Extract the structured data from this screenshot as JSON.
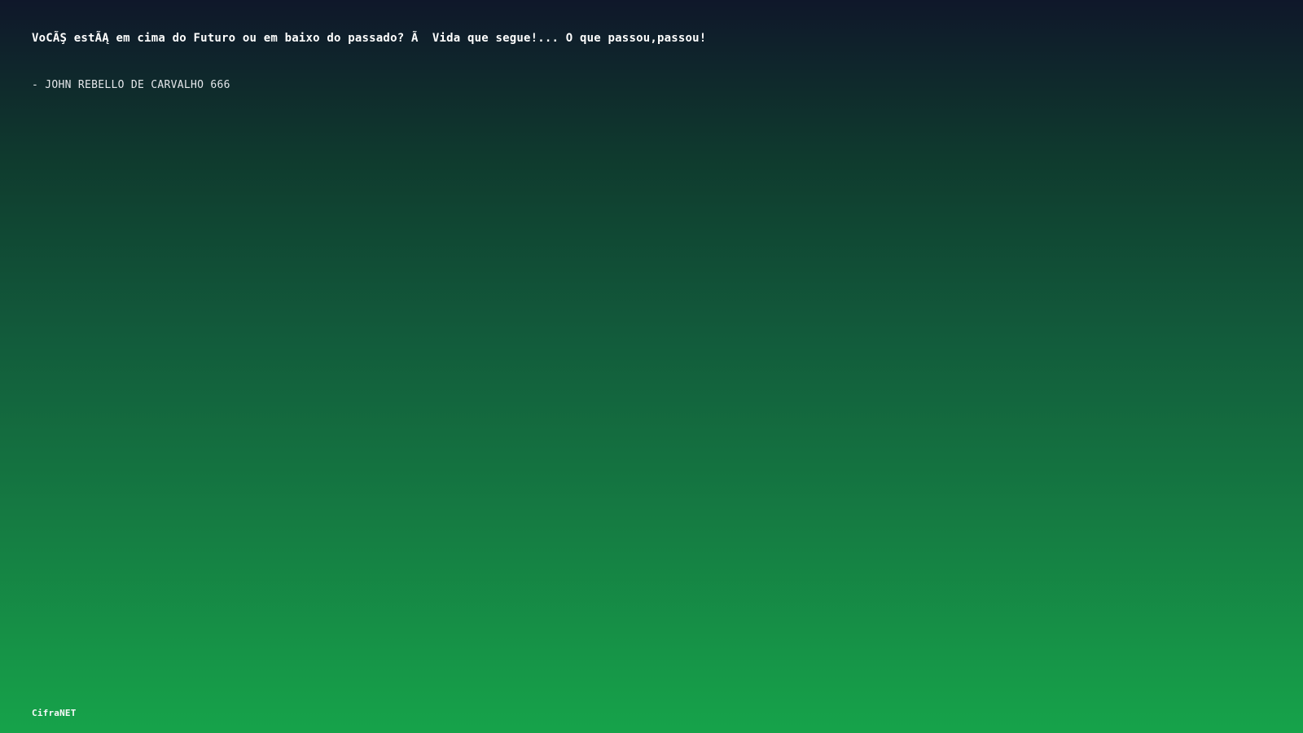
{
  "quote": {
    "text": "VoCÃŞ estÃĄ em cima do Futuro ou em baixo do passado? Ã  Vida que segue!... O que passou,passou!",
    "author": "- JOHN REBELLO DE CARVALHO 666"
  },
  "footer": {
    "brand": "CifraNET"
  },
  "colors": {
    "gradient_top": "#0f172a",
    "gradient_bottom": "#16a34a",
    "text": "#ffffff"
  }
}
